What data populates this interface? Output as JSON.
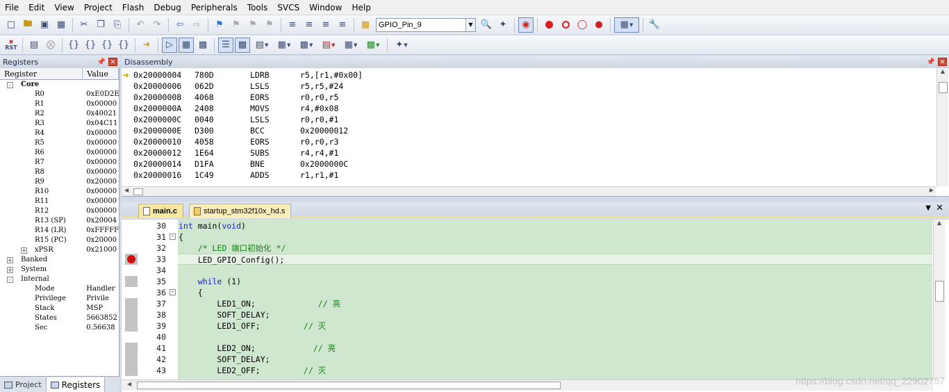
{
  "menu": [
    "File",
    "Edit",
    "View",
    "Project",
    "Flash",
    "Debug",
    "Peripherals",
    "Tools",
    "SVCS",
    "Window",
    "Help"
  ],
  "toolbar": {
    "target_combo": "GPIO_Pin_9",
    "rst_label": "RST"
  },
  "registers_panel": {
    "title": "Registers",
    "col_register": "Register",
    "col_value": "Value",
    "groups": {
      "core": "Core",
      "banked": "Banked",
      "system": "System",
      "internal": "Internal"
    },
    "core_regs": [
      {
        "name": "R0",
        "value": "0xE0D2E"
      },
      {
        "name": "R1",
        "value": "0x00000"
      },
      {
        "name": "R2",
        "value": "0x40021"
      },
      {
        "name": "R3",
        "value": "0x04C11"
      },
      {
        "name": "R4",
        "value": "0x00000"
      },
      {
        "name": "R5",
        "value": "0x00000"
      },
      {
        "name": "R6",
        "value": "0x00000"
      },
      {
        "name": "R7",
        "value": "0x00000"
      },
      {
        "name": "R8",
        "value": "0x00000"
      },
      {
        "name": "R9",
        "value": "0x20000"
      },
      {
        "name": "R10",
        "value": "0x00000"
      },
      {
        "name": "R11",
        "value": "0x00000"
      },
      {
        "name": "R12",
        "value": "0x00000"
      },
      {
        "name": "R13 (SP)",
        "value": "0x20004"
      },
      {
        "name": "R14 (LR)",
        "value": "0xFFFFF"
      },
      {
        "name": "R15 (PC)",
        "value": "0x20000"
      },
      {
        "name": "xPSR",
        "value": "0x21000"
      }
    ],
    "internal_regs": [
      {
        "name": "Mode",
        "value": "Handler"
      },
      {
        "name": "Privilege",
        "value": "Privile"
      },
      {
        "name": "Stack",
        "value": "MSP"
      },
      {
        "name": "States",
        "value": "5663852"
      },
      {
        "name": "Sec",
        "value": "0.56638"
      }
    ]
  },
  "bottom_tabs": {
    "project": "Project",
    "registers": "Registers"
  },
  "disassembly": {
    "title": "Disassembly",
    "lines": [
      {
        "addr": "0x20000004",
        "op": "780D",
        "mn": "LDRB",
        "args": "r5,[r1,#0x00]"
      },
      {
        "addr": "0x20000006",
        "op": "062D",
        "mn": "LSLS",
        "args": "r5,r5,#24"
      },
      {
        "addr": "0x20000008",
        "op": "4068",
        "mn": "EORS",
        "args": "r0,r0,r5"
      },
      {
        "addr": "0x2000000A",
        "op": "2408",
        "mn": "MOVS",
        "args": "r4,#0x08"
      },
      {
        "addr": "0x2000000C",
        "op": "0040",
        "mn": "LSLS",
        "args": "r0,r0,#1"
      },
      {
        "addr": "0x2000000E",
        "op": "D300",
        "mn": "BCC",
        "args": "0x20000012"
      },
      {
        "addr": "0x20000010",
        "op": "4058",
        "mn": "EORS",
        "args": "r0,r0,r3"
      },
      {
        "addr": "0x20000012",
        "op": "1E64",
        "mn": "SUBS",
        "args": "r4,r4,#1"
      },
      {
        "addr": "0x20000014",
        "op": "D1FA",
        "mn": "BNE",
        "args": "0x2000000C"
      },
      {
        "addr": "0x20000016",
        "op": "1C49",
        "mn": "ADDS",
        "args": "r1,r1,#1"
      }
    ]
  },
  "editor_tabs": {
    "main": "main.c",
    "startup": "startup_stm32f10x_hd.s"
  },
  "code": {
    "lines": [
      {
        "n": "30",
        "a": "int",
        "b": " main(",
        "c": "void",
        "d": ")"
      },
      {
        "n": "31",
        "a": "",
        "b": "{",
        "c": "",
        "d": ""
      },
      {
        "n": "32",
        "a": "",
        "b": "    ",
        "c": "",
        "d": "",
        "cm": "/* LED 端口初始化 */"
      },
      {
        "n": "33",
        "a": "",
        "b": "    LED_GPIO_Config();",
        "c": "",
        "d": ""
      },
      {
        "n": "34",
        "a": "",
        "b": "",
        "c": "",
        "d": ""
      },
      {
        "n": "35",
        "a": "",
        "b": "    ",
        "c": "while",
        "d": " (1)"
      },
      {
        "n": "36",
        "a": "",
        "b": "    {",
        "c": "",
        "d": ""
      },
      {
        "n": "37",
        "a": "",
        "b": "        LED1_ON;             ",
        "c": "",
        "d": "",
        "cm": "// 亮"
      },
      {
        "n": "38",
        "a": "",
        "b": "        SOFT_DELAY;",
        "c": "",
        "d": ""
      },
      {
        "n": "39",
        "a": "",
        "b": "        LED1_OFF;         ",
        "c": "",
        "d": "",
        "cm": "// 灭"
      },
      {
        "n": "40",
        "a": "",
        "b": "",
        "c": "",
        "d": ""
      },
      {
        "n": "41",
        "a": "",
        "b": "        LED2_ON;            ",
        "c": "",
        "d": "",
        "cm": "// 亮"
      },
      {
        "n": "42",
        "a": "",
        "b": "        SOFT_DELAY;",
        "c": "",
        "d": ""
      },
      {
        "n": "43",
        "a": "",
        "b": "        LED2_OFF;         ",
        "c": "",
        "d": "",
        "cm": "// 灭"
      }
    ]
  },
  "watermark": "https://blog.csdn.net/qq_22902757"
}
